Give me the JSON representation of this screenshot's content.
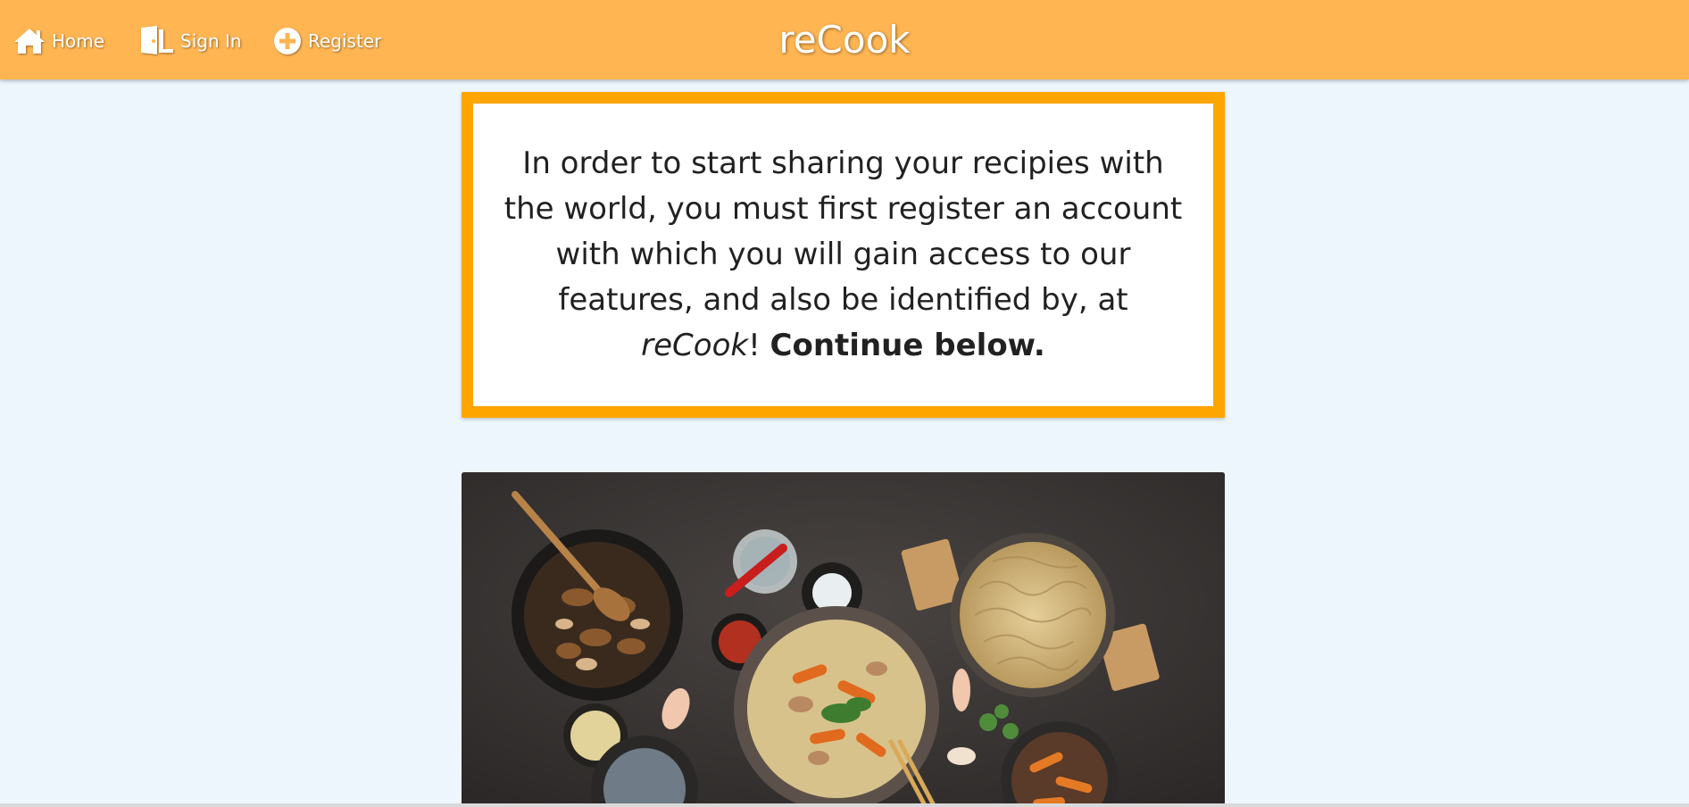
{
  "nav": {
    "home_label": "Home",
    "signin_label": "Sign In",
    "register_label": "Register",
    "brand": "reCook",
    "bar_color": "#ffb552"
  },
  "info": {
    "line_start": "In order to start sharing your recipies with the world, you must first register an account with which you will gain access to our features, and also be identified by, at ",
    "brand_italic": "reCook",
    "exclaim": "! ",
    "continue_bold": "Continue below.",
    "border_color": "#ffa500"
  },
  "hero_image": {
    "icon": "food-photo",
    "description_visible": false
  }
}
